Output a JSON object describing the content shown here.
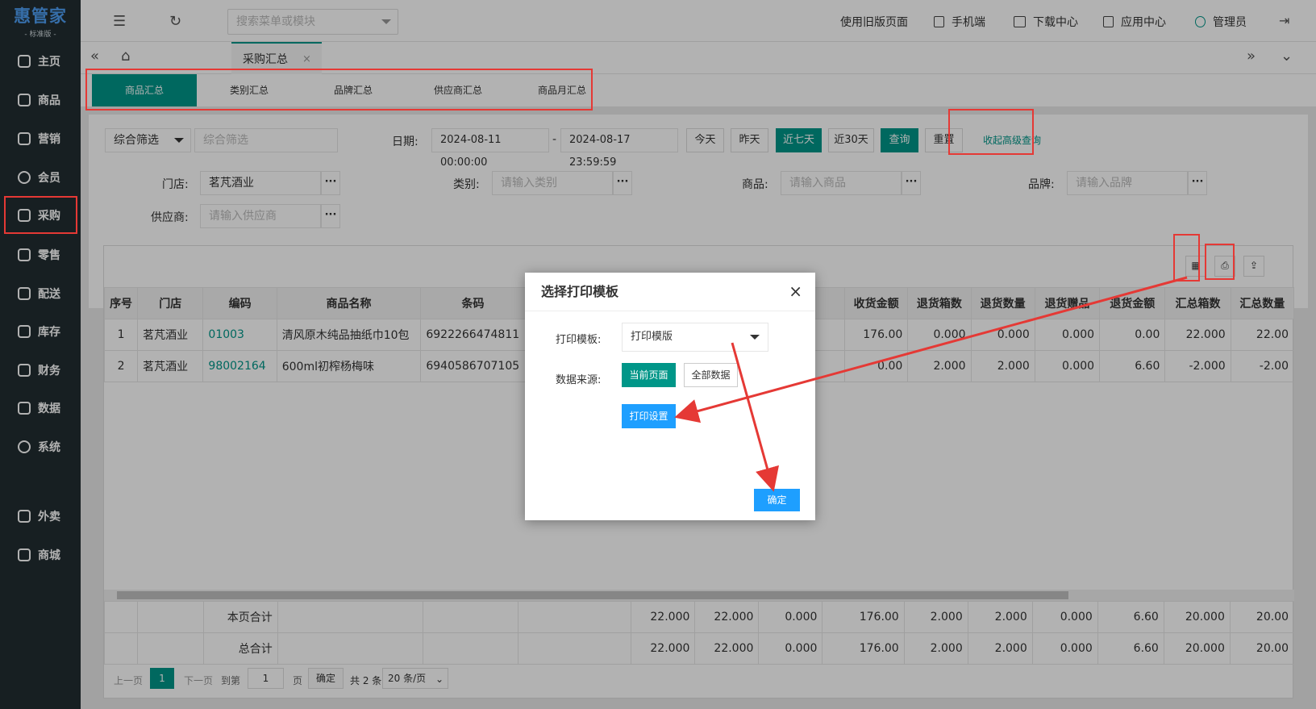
{
  "logo": {
    "title": "惠管家",
    "subtitle": "- 标准版 -"
  },
  "sidebar": {
    "items": [
      {
        "label": "主页"
      },
      {
        "label": "商品"
      },
      {
        "label": "营销"
      },
      {
        "label": "会员"
      },
      {
        "label": "采购"
      },
      {
        "label": "零售"
      },
      {
        "label": "配送"
      },
      {
        "label": "库存"
      },
      {
        "label": "财务"
      },
      {
        "label": "数据"
      },
      {
        "label": "系统"
      },
      {
        "label": "外卖"
      },
      {
        "label": "商城"
      }
    ]
  },
  "topbar": {
    "search_placeholder": "搜索菜单或模块",
    "old_page": "使用旧版页面",
    "mobile": "手机端",
    "download": "下载中心",
    "apps": "应用中心",
    "admin": "管理员"
  },
  "tabs": {
    "current": "采购汇总",
    "close": "×"
  },
  "subtabs": [
    "商品汇总",
    "类别汇总",
    "品牌汇总",
    "供应商汇总",
    "商品月汇总"
  ],
  "filters": {
    "combo_select": "综合筛选",
    "combo_placeholder": "综合筛选",
    "date_label": "日期:",
    "date_start": "2024-08-11 00:00:00",
    "date_sep": "-",
    "date_end": "2024-08-17 23:59:59",
    "btn_today": "今天",
    "btn_yesterday": "昨天",
    "btn_7days": "近七天",
    "btn_30days": "近30天",
    "btn_query": "查询",
    "btn_reset": "重置",
    "btn_collapse": "收起高级查询",
    "store_label": "门店:",
    "store_value": "茗芃酒业",
    "category_label": "类别:",
    "category_placeholder": "请输入类别",
    "product_label": "商品:",
    "product_placeholder": "请输入商品",
    "brand_label": "品牌:",
    "brand_placeholder": "请输入品牌",
    "supplier_label": "供应商:",
    "supplier_placeholder": "请输入供应商",
    "dots": "···"
  },
  "table": {
    "headers_left": [
      "序号",
      "门店",
      "编码",
      "商品名称",
      "条码"
    ],
    "headers_right": [
      "收货金额",
      "退货箱数",
      "退货数量",
      "退货赠品",
      "退货金额",
      "汇总箱数",
      "汇总数量"
    ],
    "rows": [
      {
        "idx": "1",
        "store": "茗芃酒业",
        "code": "01003",
        "name": "清风原木纯品抽纸巾10包",
        "barcode": "6922266474811",
        "r": [
          "176.00",
          "0.000",
          "0.000",
          "0.000",
          "0.00",
          "22.000",
          "22.00"
        ]
      },
      {
        "idx": "2",
        "store": "茗芃酒业",
        "code": "98002164",
        "name": "600ml初榨杨梅味",
        "barcode": "6940586707105",
        "r": [
          "0.00",
          "2.000",
          "2.000",
          "0.000",
          "6.60",
          "-2.000",
          "-2.00"
        ]
      }
    ],
    "page_total_label": "本页合计",
    "grand_total_label": "总合计",
    "totals_mid": [
      "22.000",
      "22.000",
      "0.000"
    ],
    "totals_right": [
      "176.00",
      "2.000",
      "2.000",
      "0.000",
      "6.60",
      "20.000",
      "20.00"
    ]
  },
  "pager": {
    "prev": "上一页",
    "page": "1",
    "next": "下一页",
    "goto": "到第",
    "page_input": "1",
    "page_unit": "页",
    "confirm": "确定",
    "total": "共 2 条",
    "page_size": "20 条/页"
  },
  "modal": {
    "title": "选择打印模板",
    "template_label": "打印模板:",
    "template_value": "打印模版",
    "source_label": "数据来源:",
    "btn_current": "当前页面",
    "btn_all": "全部数据",
    "btn_settings": "打印设置",
    "btn_ok": "确定",
    "close": "×"
  },
  "colors": {
    "primary": "#009688",
    "sidebar": "#222d32",
    "annotation": "#e53935",
    "blue": "#1e9fff"
  }
}
